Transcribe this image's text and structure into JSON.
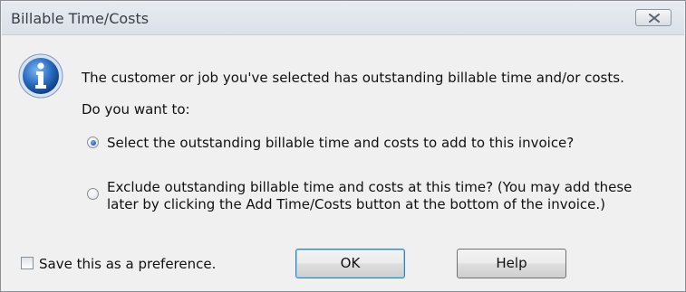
{
  "window": {
    "title": "Billable Time/Costs"
  },
  "message": {
    "line1": "The customer or job you've selected has outstanding billable time and/or costs.",
    "line2": "Do you want to:"
  },
  "options": [
    {
      "label": "Select the outstanding billable time and costs to add to this invoice?",
      "selected": true
    },
    {
      "label_line1": "Exclude outstanding billable time and costs at this time? (You may add these",
      "label_line2": "later by clicking the Add Time/Costs button at the bottom of the invoice.)",
      "selected": false
    }
  ],
  "preference": {
    "label": "Save this as a preference.",
    "checked": false
  },
  "buttons": {
    "ok": "OK",
    "help": "Help"
  },
  "icons": {
    "info": "info-icon",
    "close": "close-icon"
  },
  "colors": {
    "dialog_bg": "#f0f0f0",
    "info_blue": "#1f5ab0"
  }
}
